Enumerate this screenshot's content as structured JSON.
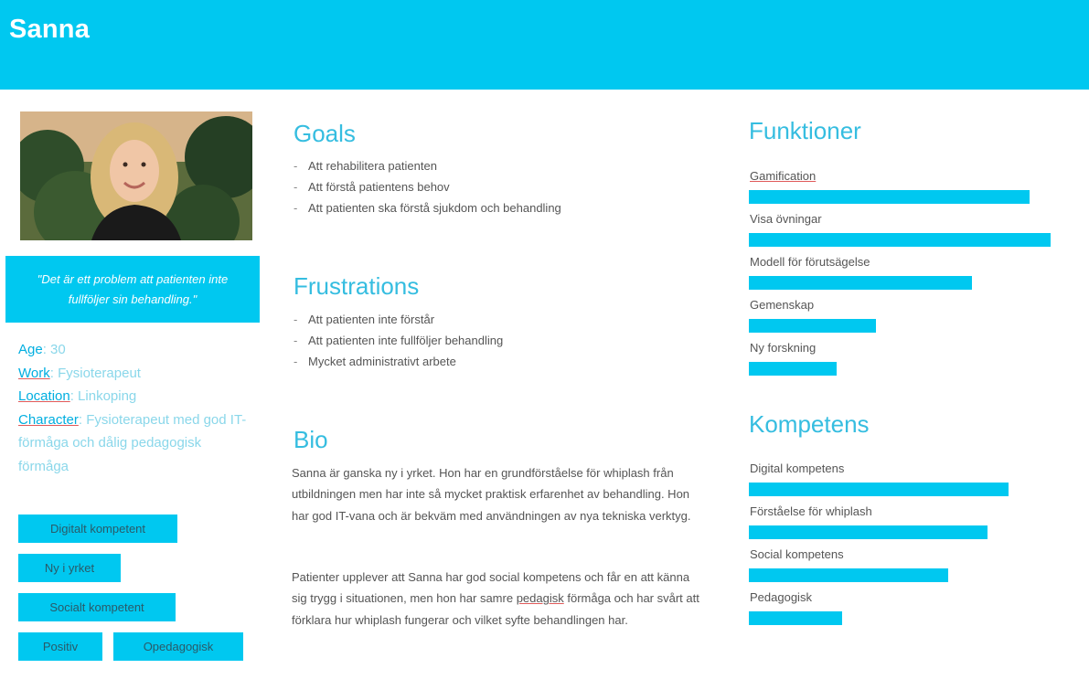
{
  "persona": {
    "name": "Sanna",
    "quote": "\"Det är ett problem att patienten inte fullföljer sin behandling.\"",
    "facts": {
      "age_label": "Age",
      "age_value": ": 30",
      "work_label": "Work",
      "work_value": ": Fysioterapeut",
      "location_label": "Location",
      "location_value": ": Linkoping",
      "character_label": "Character",
      "character_value": ": Fysioterapeut med god IT-förmåga och dålig pedagogisk förmåga"
    },
    "tags": [
      "Digitalt kompetent",
      "Ny i yrket",
      "Socialt kompetent",
      "Positiv",
      "Opedagogisk"
    ]
  },
  "goals": {
    "title": "Goals",
    "items": [
      "Att rehabilitera patienten",
      "Att förstå patientens behov",
      "Att patienten ska förstå sjukdom och behandling"
    ]
  },
  "frustrations": {
    "title": "Frustrations",
    "items": [
      "Att patienten inte förstår",
      "Att patienten inte fullföljer behandling",
      "Mycket administrativt arbete"
    ]
  },
  "bio": {
    "title": "Bio",
    "paragraph1": "Sanna är ganska ny i yrket. Hon har en grundförståelse för whiplash från utbildningen men har inte så mycket praktisk erfarenhet av behandling. Hon har god IT-vana och är bekväm med användningen av nya tekniska verktyg.",
    "paragraph2_before": "Patienter upplever att Sanna har god social kompetens och får en att känna sig trygg i situationen, men hon har samre ",
    "paragraph2_marked": "pedagisk",
    "paragraph2_after": " förmåga och har svårt att förklara hur whiplash fungerar och vilket syfte behandlingen har."
  },
  "funktioner": {
    "title": "Funktioner",
    "items": [
      {
        "label": "Gamification",
        "level": 0.93
      },
      {
        "label": "Visa övningar",
        "level": 1.0
      },
      {
        "label": "Modell för förutsägelse",
        "level": 0.74
      },
      {
        "label": "Gemenskap",
        "level": 0.42
      },
      {
        "label": "Ny forskning",
        "level": 0.29
      }
    ]
  },
  "kompetens": {
    "title": "Kompetens",
    "items": [
      {
        "label": "Digital kompetens",
        "level": 0.86
      },
      {
        "label": "Förståelse för whiplash",
        "level": 0.79
      },
      {
        "label": "Social kompetens",
        "level": 0.66
      },
      {
        "label": "Pedagogisk",
        "level": 0.31
      }
    ]
  },
  "colors": {
    "accent": "#00c8f0",
    "title": "#35bde0",
    "fact_key": "#00aee0",
    "fact_value": "#8ad7ea"
  }
}
